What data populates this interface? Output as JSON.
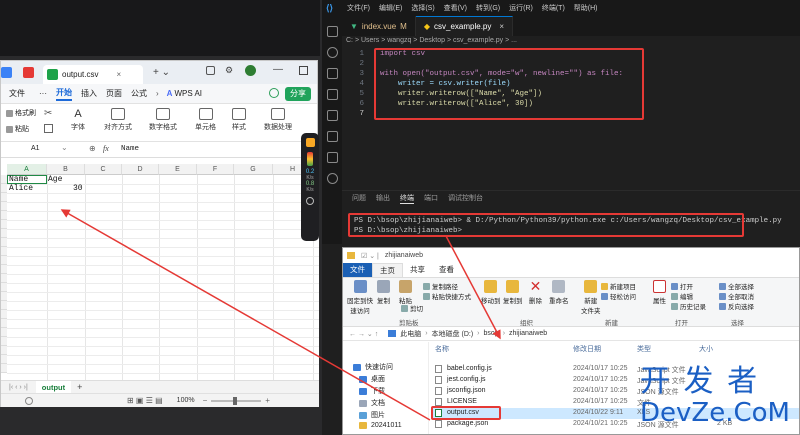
{
  "wps": {
    "tab_title": "output.csv",
    "menus": [
      "文件",
      "开始",
      "插入",
      "页面",
      "公式"
    ],
    "active_menu": "开始",
    "wps_ai": "WPS AI",
    "share": "分享",
    "ribbon": {
      "format_painter": "格式刷",
      "paste": "粘贴",
      "font": "字体",
      "alignment": "对齐方式",
      "number_format": "数字格式",
      "cells": "单元格",
      "style": "样式",
      "data_process": "数据处理"
    },
    "name_box": "A1",
    "fx": "fx",
    "formula_value": "Name",
    "columns": [
      "A",
      "B",
      "C",
      "D",
      "E",
      "F",
      "G",
      "H"
    ],
    "cells": [
      [
        "Name",
        "Age"
      ],
      [
        "Alice",
        "30"
      ]
    ],
    "sheet_tab": "output",
    "zoom": "100%"
  },
  "sidebar_float": {
    "metric1": "0.2",
    "unit1": "K/s",
    "metric2": "0.8",
    "unit2": "K/s"
  },
  "vscode": {
    "menus": [
      "文件(F)",
      "编辑(E)",
      "选择(S)",
      "查看(V)",
      "转到(G)",
      "运行(R)",
      "终端(T)",
      "帮助(H)"
    ],
    "tabs": [
      {
        "label": "index.vue",
        "badge": "M"
      },
      {
        "label": "csv_example.py",
        "badge": "×"
      }
    ],
    "breadcrumb": "C: > Users > wangzq > Desktop > csv_example.py > ...",
    "code_lines": [
      "import csv",
      "",
      "with open(\"output.csv\", mode=\"w\", newline=\"\") as file:",
      "    writer = csv.writer(file)",
      "    writer.writerow([\"Name\", \"Age\"])",
      "    writer.writerow([\"Alice\", 30])",
      ""
    ],
    "panel_tabs": [
      "问题",
      "输出",
      "终端",
      "端口",
      "调试控制台"
    ],
    "active_panel_tab": "终端",
    "terminal_lines": [
      "PS D:\\bsop\\zhijianaiweb> & D:/Python/Python39/python.exe c:/Users/wangzq/Desktop/csv_example.py",
      "PS D:\\bsop\\zhijianaiweb> "
    ]
  },
  "explorer": {
    "title": "zhijianaiweb",
    "menus": [
      "文件",
      "主页",
      "共享",
      "查看"
    ],
    "ribbon": {
      "pin": "固定到快\n速访问",
      "copy": "复制",
      "paste": "粘贴",
      "copy_path": "复制路径",
      "paste_shortcut": "粘贴快捷方式",
      "cut": "剪切",
      "clipboard": "剪贴板",
      "move_to": "移动到",
      "copy_to": "复制到",
      "delete": "删除",
      "rename": "重命名",
      "organize": "组织",
      "new_item": "新建项目",
      "easy_access": "轻松访问",
      "new_folder": "新建\n文件夹",
      "new_group": "新建",
      "properties": "属性",
      "open": "打开",
      "edit": "编辑",
      "history": "历史记录",
      "open_group": "打开",
      "select_all": "全部选择",
      "select_none": "全部取消",
      "invert": "反向选择",
      "select_group": "选择"
    },
    "address": [
      "此电脑",
      "本地磁盘 (D:)",
      "bsop",
      "zhijianaiweb"
    ],
    "nav_items": [
      "快速访问",
      "桌面",
      "下载",
      "文档",
      "图片",
      "20241011"
    ],
    "headers": [
      "名称",
      "修改日期",
      "类型",
      "大小"
    ],
    "files": [
      {
        "name": "babel.config.js",
        "date": "2024/10/17 10:25",
        "type": "JavaScript 文件",
        "size": ""
      },
      {
        "name": "jest.config.js",
        "date": "2024/10/17 10:25",
        "type": "JavaScript 文件",
        "size": ""
      },
      {
        "name": "jsconfig.json",
        "date": "2024/10/17 10:25",
        "type": "JSON 源文件",
        "size": ""
      },
      {
        "name": "LICENSE",
        "date": "2024/10/17 10:25",
        "type": "文件",
        "size": ""
      },
      {
        "name": "output.csv",
        "date": "2024/10/22 9:11",
        "type": "XLS",
        "size": ""
      },
      {
        "name": "package.json",
        "date": "2024/10/21 10:25",
        "type": "JSON 源文件",
        "size": "2 KB"
      }
    ]
  },
  "watermark": {
    "cn": "开 发 者",
    "en": "DevZe.CoM"
  }
}
